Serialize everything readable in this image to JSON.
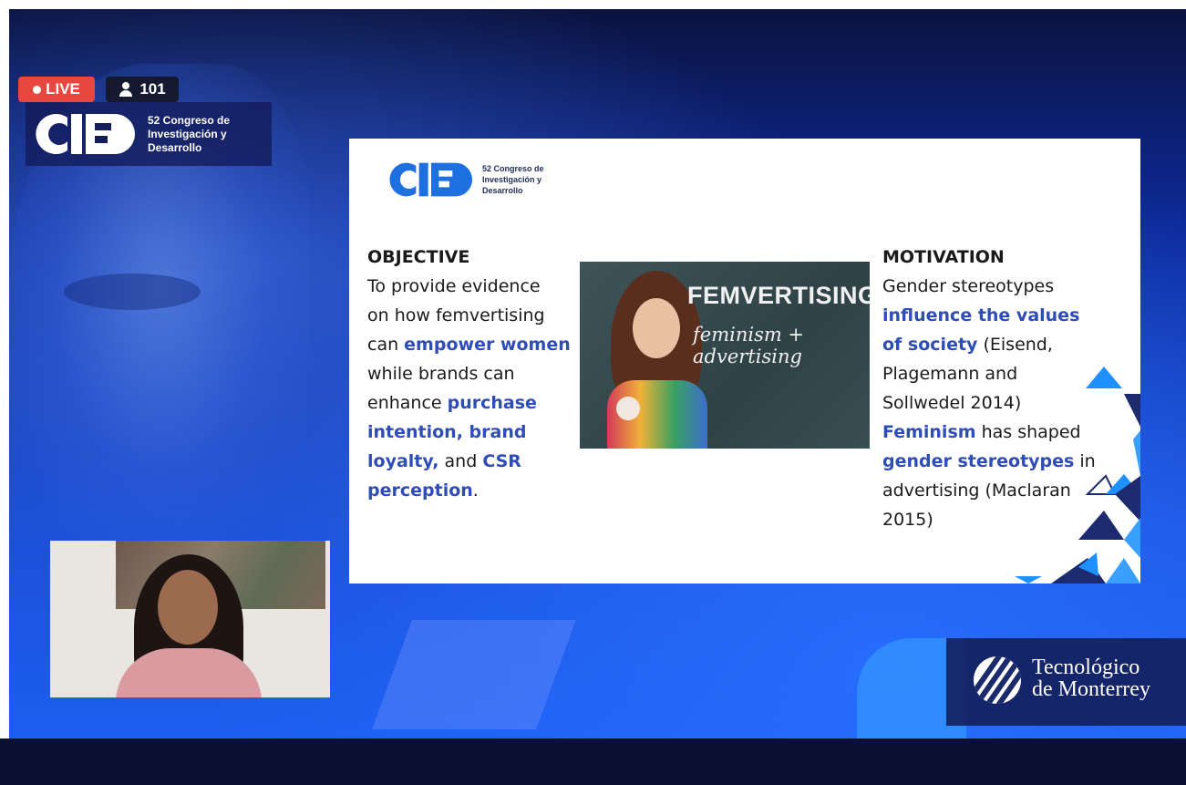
{
  "stream": {
    "live_label": "LIVE",
    "viewer_count": "101"
  },
  "event_logo": {
    "line1": "52 Congreso de",
    "line2": "Investigación y",
    "line3": "Desarrollo"
  },
  "slide": {
    "objective": {
      "heading": "OBJECTIVE",
      "t1": "To provide evidence",
      "t2": "on how femvertising",
      "t3": "can ",
      "h1": "empower women",
      "t4": "while brands can",
      "t5": "enhance ",
      "h2": "purchase",
      "h3": "intention, brand",
      "h4": "loyalty,",
      "t6": " and ",
      "h5": "CSR",
      "h6": "perception",
      "t7": "."
    },
    "image": {
      "title": "FEMVERTISING",
      "subtitle": "feminism + advertising"
    },
    "motivation": {
      "heading": "MOTIVATION",
      "t1": "Gender stereotypes",
      "h1": "influence the values",
      "h2": "of society",
      "t2": " (Eisend,",
      "t3": "Plagemann and",
      "t4": "Sollwedel 2014)",
      "h3": "Feminism",
      "t5": " has shaped",
      "h4": "gender stereotypes",
      "t6": " in",
      "t7": "advertising (Maclaran",
      "t8": "2015)"
    }
  },
  "sponsor": {
    "line1": "Tecnológico",
    "line2": "de Monterrey"
  },
  "colors": {
    "live_red": "#e8473f",
    "highlight_blue": "#2f4db8",
    "logo_blue": "#1e6fe0"
  }
}
